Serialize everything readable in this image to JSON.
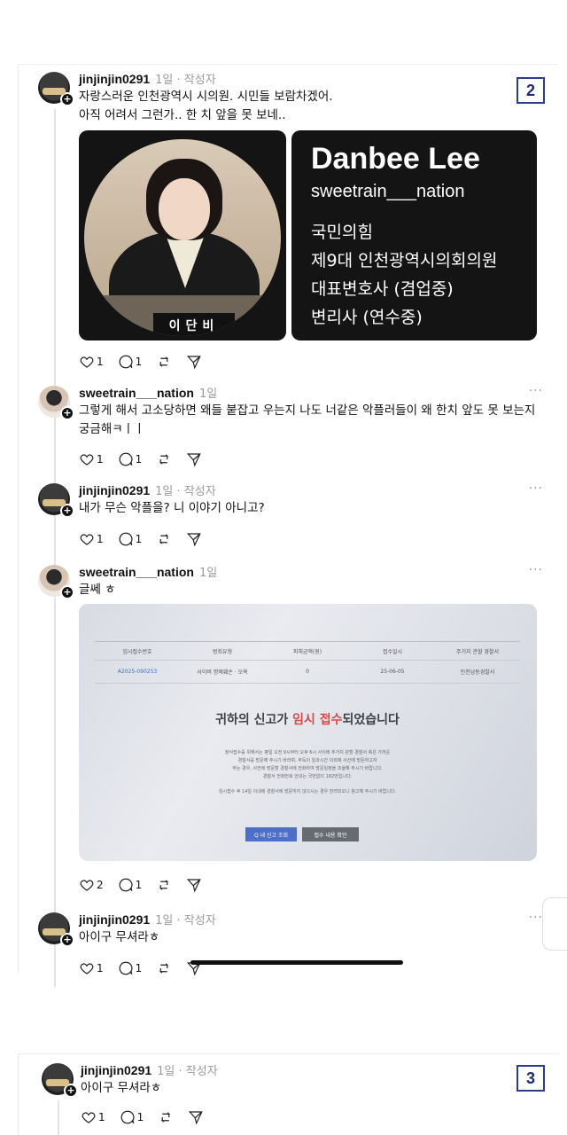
{
  "panel2": {
    "page_number": "2",
    "posts": [
      {
        "user": "jinjinjin0291",
        "meta": "1일 · 작성자",
        "lines": [
          "자랑스러운 인천광역시 시의원. 시민들 보람차겠어.",
          "아직 어려서 그런가.. 한 치 앞을 못 보네.."
        ],
        "likes": "1",
        "replies": "1"
      },
      {
        "user": "sweetrain___nation",
        "meta": "1일",
        "lines": [
          "그렇게 해서 고소당하면 왜들 붙잡고 우는지 나도 너같은 악플러들이 왜 한치 앞도 못 보는지",
          "궁금해ㅋㅣㅣ"
        ],
        "likes": "1",
        "replies": "1"
      },
      {
        "user": "jinjinjin0291",
        "meta": "1일 · 작성자",
        "lines": [
          "내가 무슨 악플을? 니 이야기 아니고?"
        ],
        "likes": "1",
        "replies": "1"
      },
      {
        "user": "sweetrain___nation",
        "meta": "1일",
        "lines": [
          "글쎄 ㅎ"
        ],
        "likes": "2",
        "replies": "1"
      },
      {
        "user": "jinjinjin0291",
        "meta": "1일 · 작성자",
        "lines": [
          "아이구 무셔라ㅎ"
        ],
        "likes": "1",
        "replies": "1"
      }
    ],
    "profile_card": {
      "nameplate": "이단비",
      "name": "Danbee Lee",
      "handle": "sweetrain___nation",
      "lines": [
        "국민의힘",
        "제9대 인천광역시의회의원",
        "대표변호사 (겸업중)",
        "변리사 (연수중)"
      ]
    },
    "report_screenshot": {
      "columns": [
        "임시접수번호",
        "범죄유형",
        "피해금액(원)",
        "접수일시",
        "주거지 관할 경찰서"
      ],
      "row": [
        "A2025-090253",
        "사이버 명예훼손 · 모욕",
        "0",
        "25-06-05",
        "인천남동경찰서"
      ],
      "title_prefix": "귀하의 신고가 ",
      "title_highlight": "임시 접수",
      "title_suffix": "되었습니다",
      "body_lines": [
        "정식접수를 위해서는 평일 오전 9시부터 오후 6시 사이에 주거지 관할 경찰서 혹은 가까운",
        "경찰서를 방문해 주시기 바라며, 부득이 일과시간 이외에 사건에 방문하고자",
        "하는 경우, 사전에 방문할 경찰서에 전화하여 방문일정을 조율해 주시기 바랍니다.",
        "경찰서 전화번호 안내는 국번없이 182번입니다.",
        "임시접수 후 14일 이내에 경찰서에 방문하지 않으시는 경우 반려되오니 참고해 주시기 바랍니다."
      ],
      "btn_search": "Q 내 신고 조회",
      "btn_detail": "접수 내용 확인"
    }
  },
  "panel3": {
    "page_number": "3",
    "post": {
      "user": "jinjinjin0291",
      "meta": "1일 · 작성자",
      "lines": [
        "아이구 무셔라ㅎ"
      ],
      "likes": "1",
      "replies": "1"
    }
  },
  "icons": [
    "heart-icon",
    "comment-icon",
    "repost-icon",
    "share-icon",
    "more-icon",
    "plus-icon"
  ]
}
